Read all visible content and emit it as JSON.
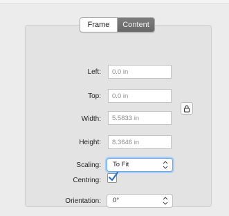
{
  "tabs": {
    "frame": "Frame",
    "content": "Content",
    "selected": "Content"
  },
  "fields": {
    "left": {
      "label": "Left:",
      "value": "0.0 in"
    },
    "top": {
      "label": "Top:",
      "value": "0.0 in"
    },
    "width": {
      "label": "Width:",
      "value": "5.5833 in"
    },
    "height": {
      "label": "Height:",
      "value": "8.3646 in"
    }
  },
  "scaling": {
    "label": "Scaling:",
    "value": "To Fit"
  },
  "centring": {
    "label": "Centring:",
    "checked": true
  },
  "orientation": {
    "label": "Orientation:",
    "value": "0°"
  },
  "colors": {
    "focus": "#6aa7e6",
    "check": "#2a72c8",
    "selected_tab": "#6f6f6f"
  },
  "icons": {
    "lock": "lock-icon",
    "stepper": "up-down-arrows-icon",
    "check": "checkmark-icon"
  }
}
